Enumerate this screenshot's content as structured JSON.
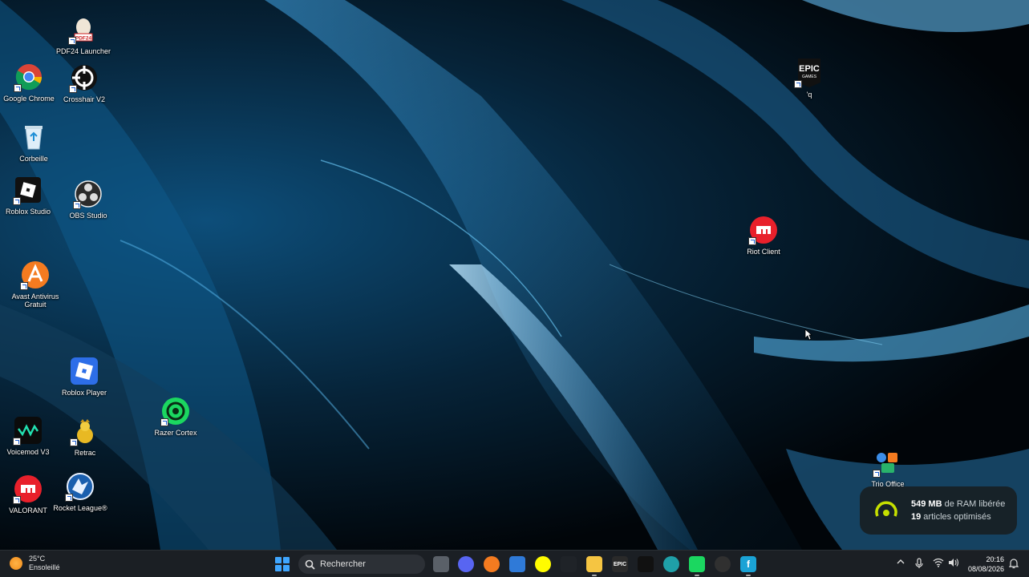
{
  "desktop": {
    "icons": [
      {
        "id": "pdf24",
        "label": "PDF24 Launcher"
      },
      {
        "id": "chrome",
        "label": "Google Chrome"
      },
      {
        "id": "crosshair",
        "label": "Crosshair V2"
      },
      {
        "id": "recycle",
        "label": "Corbeille"
      },
      {
        "id": "roblox-studio",
        "label": "Roblox Studio"
      },
      {
        "id": "obs",
        "label": "OBS Studio"
      },
      {
        "id": "avast",
        "label": "Avast Antivirus\nGratuit"
      },
      {
        "id": "roblox-player",
        "label": "Roblox Player"
      },
      {
        "id": "razer-cortex",
        "label": "Razer Cortex"
      },
      {
        "id": "voicemod",
        "label": "Voicemod V3"
      },
      {
        "id": "retrac",
        "label": "Retrac"
      },
      {
        "id": "valorant",
        "label": "VALORANT"
      },
      {
        "id": "rocket-league",
        "label": "Rocket League®"
      },
      {
        "id": "epic",
        "label": "'q"
      },
      {
        "id": "riot",
        "label": "Riot Client"
      },
      {
        "id": "trio",
        "label": "Trio Office"
      }
    ],
    "epic_logo_text": [
      "EPIC",
      "GAMES"
    ]
  },
  "toast": {
    "amount": "549 MB",
    "line1_rest": " de RAM libérée",
    "count": "19",
    "line2_rest": " articles optimisés"
  },
  "taskbar": {
    "weather_temp": "25°C",
    "weather_desc": "Ensoleillé",
    "search_placeholder": "Rechercher",
    "apps": [
      {
        "name": "task-view",
        "color": "#5a6068"
      },
      {
        "name": "discord",
        "color": "#5865f2"
      },
      {
        "name": "avast",
        "color": "#f47b20"
      },
      {
        "name": "store",
        "color": "#2f7ad8"
      },
      {
        "name": "snapchat",
        "color": "#fffc00"
      },
      {
        "name": "dark-app",
        "color": "#1f2328"
      },
      {
        "name": "file-explorer",
        "color": "#f5c542"
      },
      {
        "name": "epic-games",
        "color": "#2a2a2a",
        "label": "EPIC"
      },
      {
        "name": "tiktok",
        "color": "#111111"
      },
      {
        "name": "edge",
        "color": "#1fa0a8"
      },
      {
        "name": "razer-cortex",
        "color": "#1bd760"
      },
      {
        "name": "obs",
        "color": "#303030"
      },
      {
        "name": "facebook-app",
        "color": "#1aa3d6",
        "label": "f"
      }
    ],
    "time": "20:16",
    "date": "08/08/2026"
  },
  "colors": {
    "accent": "#3fa6ff",
    "taskbar_bg": "#1b1f24"
  }
}
